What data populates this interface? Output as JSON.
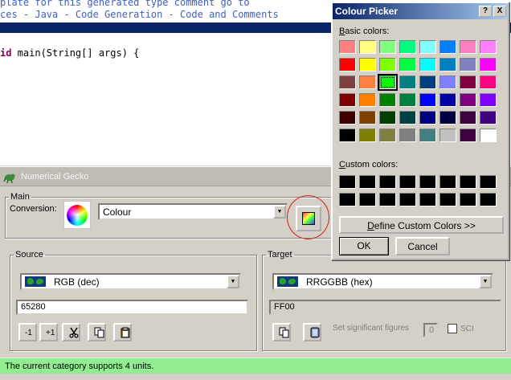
{
  "editor": {
    "line1": "plate for this generated type comment go to",
    "line2": "ces - Java - Code Generation - Code and Comments",
    "line3_keyword": "id",
    "line3_rest": " main(String[] args) {"
  },
  "gecko": {
    "title": "Numerical Gecko",
    "main_legend": "Main",
    "conversion_label": "Conversion:",
    "conversion_value": "Colour",
    "source": {
      "legend": "Source",
      "unit": "RGB (dec)",
      "value": "65280",
      "buttons": {
        "neg": "-1",
        "pos": "+1"
      }
    },
    "target": {
      "legend": "Target",
      "unit": "RRGGBB (hex)",
      "value": "FF00",
      "sig_label": "Set significant figures",
      "sig_value": "0",
      "sci_label": "SCI"
    },
    "status": "The current category supports 4 units."
  },
  "picker": {
    "title": "Colour Picker",
    "help": "?",
    "close": "X",
    "basic_label": "Basic colors:",
    "custom_label": "Custom colors:",
    "define_button": "Define Custom Colors >>",
    "ok_button": "OK",
    "cancel_button": "Cancel",
    "selected_index": 18,
    "basic_colors": [
      "#ff8080",
      "#ffff80",
      "#80ff80",
      "#00ff80",
      "#80ffff",
      "#0080ff",
      "#ff80c0",
      "#ff80ff",
      "#ff0000",
      "#ffff00",
      "#80ff00",
      "#00ff40",
      "#00ffff",
      "#0080c0",
      "#8080c0",
      "#ff00ff",
      "#804040",
      "#ff8040",
      "#00ff00",
      "#008080",
      "#004080",
      "#8080ff",
      "#800040",
      "#ff0080",
      "#800000",
      "#ff8000",
      "#008000",
      "#008040",
      "#0000ff",
      "#0000a0",
      "#800080",
      "#8000ff",
      "#400000",
      "#804000",
      "#004000",
      "#004040",
      "#000080",
      "#000040",
      "#400040",
      "#400080",
      "#000000",
      "#808000",
      "#808040",
      "#808080",
      "#408080",
      "#c0c0c0",
      "#400040",
      "#ffffff"
    ],
    "custom_colors": [
      "#000000",
      "#000000",
      "#000000",
      "#000000",
      "#000000",
      "#000000",
      "#000000",
      "#000000",
      "#000000",
      "#000000",
      "#000000",
      "#000000",
      "#000000",
      "#000000",
      "#000000",
      "#000000"
    ]
  }
}
